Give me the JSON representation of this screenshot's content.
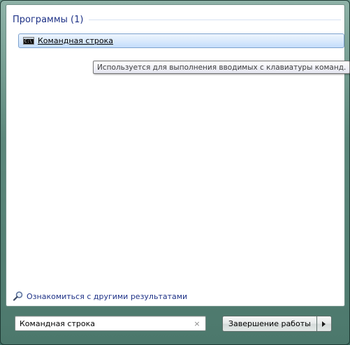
{
  "section": {
    "title": "Программы (1)"
  },
  "results": [
    {
      "label": "Командная строка",
      "icon": "cmd-icon",
      "icon_glyph": "C:\\"
    }
  ],
  "tooltip": {
    "text": "Используется для выполнения вводимых с клавиатуры команд."
  },
  "see_more": {
    "label": "Ознакомиться с другими результатами",
    "icon": "search-icon"
  },
  "search": {
    "value": "Командная строка",
    "clear_icon": "×"
  },
  "shutdown": {
    "label": "Завершение работы",
    "arrow_icon": "arrow-right-icon"
  },
  "colors": {
    "link": "#1e3287",
    "selection_border": "#7da2ce",
    "selection_fill": "#dcebfc",
    "frame_glass": "#5c877b"
  }
}
